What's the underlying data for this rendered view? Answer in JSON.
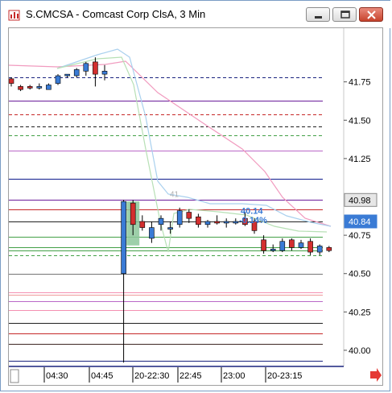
{
  "window": {
    "title": "S.CMCSA - Comcast Corp ClsA, 3 Min",
    "icons": [
      "chart-app-icon",
      "minimize-icon",
      "maximize-icon",
      "close-icon"
    ]
  },
  "colors": {
    "up_candle": "#3a7bd5",
    "down_candle": "#d32f2f",
    "highlight_candle": "#8cc79a",
    "current_price_badge": "#3a7bd5",
    "scroll_arrow": "#e53935"
  },
  "chart_data": {
    "type": "candlestick",
    "price_axis": {
      "ticks": [
        "41.75",
        "41.50",
        "41.25",
        "40.75",
        "40.50",
        "40.25",
        "40.00"
      ],
      "range": [
        39.9,
        42.1
      ]
    },
    "price_tags": [
      {
        "label": "40.98",
        "price": 40.98,
        "style": "gray"
      },
      {
        "label": "40.84",
        "price": 40.84,
        "style": "current"
      }
    ],
    "time_axis": {
      "ticks": [
        "04:30",
        "04:45",
        "20-22:30",
        "22:45",
        "23:00",
        "20-23:15"
      ]
    },
    "candles": [
      {
        "o": 41.77,
        "h": 41.78,
        "l": 41.72,
        "c": 41.74
      },
      {
        "o": 41.72,
        "h": 41.73,
        "l": 41.69,
        "c": 41.7
      },
      {
        "o": 41.72,
        "h": 41.73,
        "l": 41.7,
        "c": 41.71
      },
      {
        "o": 41.72,
        "h": 41.74,
        "l": 41.7,
        "c": 41.72
      },
      {
        "o": 41.7,
        "h": 41.74,
        "l": 41.7,
        "c": 41.73
      },
      {
        "o": 41.74,
        "h": 41.8,
        "l": 41.73,
        "c": 41.79
      },
      {
        "o": 41.79,
        "h": 41.8,
        "l": 41.78,
        "c": 41.8
      },
      {
        "o": 41.79,
        "h": 41.84,
        "l": 41.78,
        "c": 41.83
      },
      {
        "o": 41.82,
        "h": 41.88,
        "l": 41.79,
        "c": 41.87
      },
      {
        "o": 41.88,
        "h": 41.91,
        "l": 41.72,
        "c": 41.8
      },
      {
        "o": 41.8,
        "h": 41.86,
        "l": 41.76,
        "c": 41.82
      },
      {
        "o": 40.5,
        "h": 40.98,
        "l": 39.92,
        "c": 40.97
      },
      {
        "o": 40.96,
        "h": 40.98,
        "l": 40.75,
        "c": 40.82
      },
      {
        "o": 40.84,
        "h": 40.88,
        "l": 40.78,
        "c": 40.8
      },
      {
        "o": 40.73,
        "h": 40.84,
        "l": 40.7,
        "c": 40.8
      },
      {
        "o": 40.82,
        "h": 40.88,
        "l": 40.78,
        "c": 40.86
      },
      {
        "o": 40.79,
        "h": 40.84,
        "l": 40.76,
        "c": 40.8
      },
      {
        "o": 40.82,
        "h": 40.93,
        "l": 40.8,
        "c": 40.91
      },
      {
        "o": 40.9,
        "h": 40.92,
        "l": 40.83,
        "c": 40.86
      },
      {
        "o": 40.87,
        "h": 40.89,
        "l": 40.8,
        "c": 40.82
      },
      {
        "o": 40.82,
        "h": 40.85,
        "l": 40.8,
        "c": 40.84
      },
      {
        "o": 40.84,
        "h": 40.88,
        "l": 40.82,
        "c": 40.83
      },
      {
        "o": 40.83,
        "h": 40.86,
        "l": 40.8,
        "c": 40.84
      },
      {
        "o": 40.84,
        "h": 40.86,
        "l": 40.82,
        "c": 40.84
      },
      {
        "o": 40.86,
        "h": 40.9,
        "l": 40.81,
        "c": 40.82
      },
      {
        "o": 40.84,
        "h": 40.86,
        "l": 40.76,
        "c": 40.78
      },
      {
        "o": 40.72,
        "h": 40.75,
        "l": 40.63,
        "c": 40.65
      },
      {
        "o": 40.66,
        "h": 40.69,
        "l": 40.64,
        "c": 40.66
      },
      {
        "o": 40.65,
        "h": 40.73,
        "l": 40.64,
        "c": 40.71
      },
      {
        "o": 40.72,
        "h": 40.73,
        "l": 40.65,
        "c": 40.67
      },
      {
        "o": 40.67,
        "h": 40.72,
        "l": 40.66,
        "c": 40.7
      },
      {
        "o": 40.71,
        "h": 40.73,
        "l": 40.62,
        "c": 40.64
      },
      {
        "o": 40.64,
        "h": 40.69,
        "l": 40.62,
        "c": 40.68
      },
      {
        "o": 40.67,
        "h": 40.68,
        "l": 40.64,
        "c": 40.65
      }
    ],
    "highlight_candle_index": 12,
    "horizontal_levels": [
      {
        "price": 41.78,
        "color": "#1a237e",
        "dash": true
      },
      {
        "price": 41.63,
        "color": "#6a1b9a",
        "dash": false
      },
      {
        "price": 41.54,
        "color": "#c62828",
        "dash": true
      },
      {
        "price": 41.46,
        "color": "#212121",
        "dash": true
      },
      {
        "price": 41.4,
        "color": "#43a047",
        "dash": true
      },
      {
        "price": 41.3,
        "color": "#ba68c8",
        "dash": false
      },
      {
        "price": 41.12,
        "color": "#0d1a8c",
        "dash": false
      },
      {
        "price": 40.98,
        "color": "#6a1b9a",
        "dash": false
      },
      {
        "price": 40.92,
        "color": "#c62828",
        "dash": false
      },
      {
        "price": 40.84,
        "color": "#212121",
        "dash": false
      },
      {
        "price": 40.74,
        "color": "#43a047",
        "dash": false
      },
      {
        "price": 40.67,
        "color": "#43a047",
        "dash": false
      },
      {
        "price": 40.65,
        "color": "#43a047",
        "dash": false
      },
      {
        "price": 40.62,
        "color": "#43a047",
        "dash": true
      },
      {
        "price": 40.5,
        "color": "#757575",
        "dash": false
      },
      {
        "price": 40.38,
        "color": "#f48fb1",
        "dash": false
      },
      {
        "price": 40.36,
        "color": "#ef9a9a",
        "dash": false
      },
      {
        "price": 40.32,
        "color": "#ba68c8",
        "dash": false
      },
      {
        "price": 40.26,
        "color": "#f48fb1",
        "dash": false
      },
      {
        "price": 40.18,
        "color": "#212121",
        "dash": false
      },
      {
        "price": 40.11,
        "color": "#c62828",
        "dash": false
      },
      {
        "price": 40.04,
        "color": "#3e2723",
        "dash": false
      },
      {
        "price": 39.93,
        "color": "#1a237e",
        "dash": false
      }
    ],
    "annotations": [
      {
        "text": "41",
        "price": 40.99,
        "color": "#b0b0b0"
      },
      {
        "text": "40.14",
        "price": 40.88,
        "color": "#3a7bd5"
      },
      {
        "text": "-0.14%",
        "price": 40.82,
        "color": "#3a7bd5"
      }
    ]
  }
}
